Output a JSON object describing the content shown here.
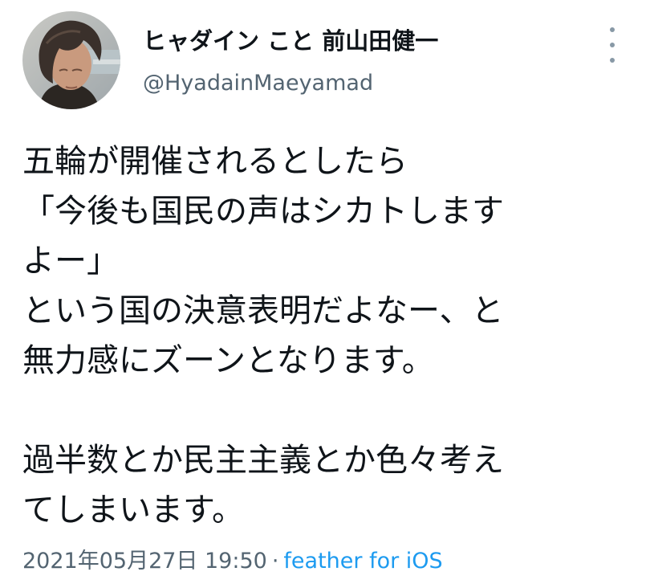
{
  "tweet": {
    "author": {
      "display_name": "ヒャダイン こと 前山田健一",
      "handle": "@HyadainMaeyamad",
      "avatar_icon": "profile-photo"
    },
    "menu_icon": "more-vertical-icon",
    "text_lines": [
      "五輪が開催されるとしたら",
      "「今後も国民の声はシカトします",
      "よー」",
      "という国の決意表明だよなー、と",
      "無力感にズーンとなります。",
      "",
      "過半数とか民主主義とか色々考え",
      "てしまいます。"
    ],
    "timestamp": "2021年05月27日 19:50",
    "separator": "·",
    "source": "feather for iOS"
  },
  "colors": {
    "text": "#0f1419",
    "secondary": "#536471",
    "link": "#1d9bf0",
    "background": "#ffffff"
  }
}
